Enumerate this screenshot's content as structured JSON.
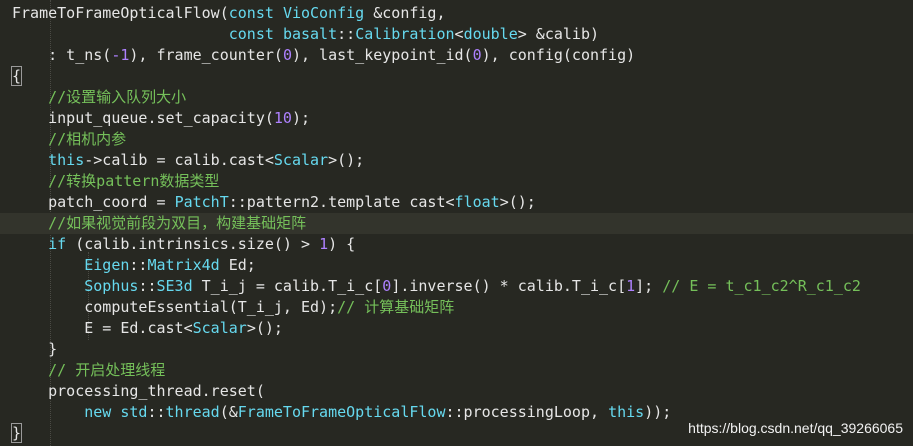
{
  "code_lines": [
    {
      "indent": 0,
      "tokens": [
        {
          "t": "FrameToFrameOpticalFlow",
          "c": "plain"
        },
        {
          "t": "(",
          "c": "plain"
        },
        {
          "t": "const ",
          "c": "kw"
        },
        {
          "t": "VioConfig ",
          "c": "type"
        },
        {
          "t": "&config,",
          "c": "plain"
        }
      ]
    },
    {
      "indent": 0,
      "tokens": [
        {
          "t": "                        ",
          "c": "plain"
        },
        {
          "t": "const ",
          "c": "kw"
        },
        {
          "t": "basalt",
          "c": "ns"
        },
        {
          "t": "::",
          "c": "plain"
        },
        {
          "t": "Calibration",
          "c": "type"
        },
        {
          "t": "<",
          "c": "plain"
        },
        {
          "t": "double",
          "c": "kw"
        },
        {
          "t": "> &calib)",
          "c": "plain"
        }
      ]
    },
    {
      "indent": 0,
      "tokens": [
        {
          "t": "    : t_ns(",
          "c": "plain"
        },
        {
          "t": "-1",
          "c": "num"
        },
        {
          "t": "), frame_counter(",
          "c": "plain"
        },
        {
          "t": "0",
          "c": "num"
        },
        {
          "t": "), last_keypoint_id(",
          "c": "plain"
        },
        {
          "t": "0",
          "c": "num"
        },
        {
          "t": "), config(config)",
          "c": "plain"
        }
      ]
    },
    {
      "indent": 0,
      "tokens": [
        {
          "t": "{",
          "c": "bracket"
        }
      ]
    },
    {
      "indent": 0,
      "tokens": [
        {
          "t": "    //设置输入队列大小",
          "c": "cmt"
        }
      ]
    },
    {
      "indent": 0,
      "tokens": [
        {
          "t": "    input_queue.set_capacity(",
          "c": "plain"
        },
        {
          "t": "10",
          "c": "num"
        },
        {
          "t": ");",
          "c": "plain"
        }
      ]
    },
    {
      "indent": 0,
      "tokens": [
        {
          "t": "    //相机内参",
          "c": "cmt"
        }
      ]
    },
    {
      "indent": 0,
      "tokens": [
        {
          "t": "    ",
          "c": "plain"
        },
        {
          "t": "this",
          "c": "kw"
        },
        {
          "t": "->calib = calib.cast<",
          "c": "plain"
        },
        {
          "t": "Scalar",
          "c": "type"
        },
        {
          "t": ">();",
          "c": "plain"
        }
      ]
    },
    {
      "indent": 0,
      "tokens": [
        {
          "t": "    //转换pattern数据类型",
          "c": "cmt"
        }
      ]
    },
    {
      "indent": 0,
      "tokens": [
        {
          "t": "    patch_coord = ",
          "c": "plain"
        },
        {
          "t": "PatchT",
          "c": "type"
        },
        {
          "t": "::pattern2.template cast<",
          "c": "plain"
        },
        {
          "t": "float",
          "c": "kw"
        },
        {
          "t": ">();",
          "c": "plain"
        }
      ]
    },
    {
      "indent": 0,
      "hl": true,
      "tokens": [
        {
          "t": "    //如果视觉前段为双目，构建基础矩阵",
          "c": "cmt"
        }
      ]
    },
    {
      "indent": 0,
      "tokens": [
        {
          "t": "    ",
          "c": "plain"
        },
        {
          "t": "if",
          "c": "kw"
        },
        {
          "t": " (calib.intrinsics.size() > ",
          "c": "plain"
        },
        {
          "t": "1",
          "c": "num"
        },
        {
          "t": ") {",
          "c": "plain"
        }
      ]
    },
    {
      "indent": 0,
      "tokens": [
        {
          "t": "        ",
          "c": "plain"
        },
        {
          "t": "Eigen",
          "c": "ns"
        },
        {
          "t": "::",
          "c": "plain"
        },
        {
          "t": "Matrix4d",
          "c": "type"
        },
        {
          "t": " Ed;",
          "c": "plain"
        }
      ]
    },
    {
      "indent": 0,
      "tokens": [
        {
          "t": "        ",
          "c": "plain"
        },
        {
          "t": "Sophus",
          "c": "ns"
        },
        {
          "t": "::",
          "c": "plain"
        },
        {
          "t": "SE3d",
          "c": "type"
        },
        {
          "t": " T_i_j = calib.T_i_c[",
          "c": "plain"
        },
        {
          "t": "0",
          "c": "num"
        },
        {
          "t": "].inverse() * calib.T_i_c[",
          "c": "plain"
        },
        {
          "t": "1",
          "c": "num"
        },
        {
          "t": "]; ",
          "c": "plain"
        },
        {
          "t": "// E = t_c1_c2^R_c1_c2",
          "c": "cmt"
        }
      ]
    },
    {
      "indent": 0,
      "tokens": [
        {
          "t": "        computeEssential(T_i_j, Ed);",
          "c": "plain"
        },
        {
          "t": "// 计算基础矩阵",
          "c": "cmt"
        }
      ]
    },
    {
      "indent": 0,
      "tokens": [
        {
          "t": "        E = Ed.cast<",
          "c": "plain"
        },
        {
          "t": "Scalar",
          "c": "type"
        },
        {
          "t": ">();",
          "c": "plain"
        }
      ]
    },
    {
      "indent": 0,
      "tokens": [
        {
          "t": "    }",
          "c": "plain"
        }
      ]
    },
    {
      "indent": 0,
      "tokens": [
        {
          "t": "    // 开启处理线程",
          "c": "cmt"
        }
      ]
    },
    {
      "indent": 0,
      "tokens": [
        {
          "t": "    processing_thread.reset(",
          "c": "plain"
        }
      ]
    },
    {
      "indent": 0,
      "tokens": [
        {
          "t": "        ",
          "c": "plain"
        },
        {
          "t": "new",
          "c": "kw"
        },
        {
          "t": " ",
          "c": "plain"
        },
        {
          "t": "std",
          "c": "ns"
        },
        {
          "t": "::",
          "c": "plain"
        },
        {
          "t": "thread",
          "c": "type"
        },
        {
          "t": "(&",
          "c": "plain"
        },
        {
          "t": "FrameToFrameOpticalFlow",
          "c": "type"
        },
        {
          "t": "::processingLoop, ",
          "c": "plain"
        },
        {
          "t": "this",
          "c": "kw"
        },
        {
          "t": "));",
          "c": "plain"
        }
      ]
    },
    {
      "indent": 0,
      "tokens": [
        {
          "t": "}",
          "c": "bracket"
        }
      ]
    }
  ],
  "watermark": "https://blog.csdn.net/qq_39266065",
  "colors": {
    "background": "#272822",
    "plain": "#e6e6e6",
    "keyword": "#66d9ef",
    "number": "#ae81ff",
    "comment": "#75c05a"
  }
}
